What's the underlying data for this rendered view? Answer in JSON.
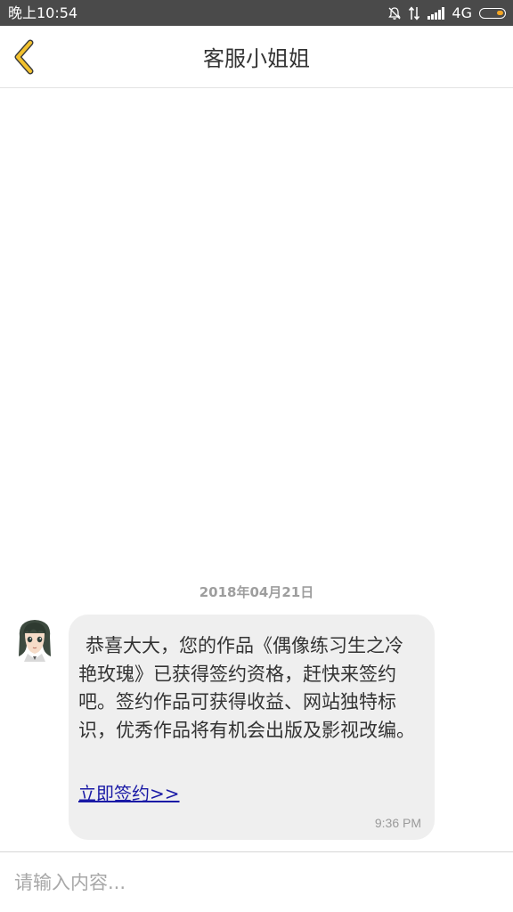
{
  "status_bar": {
    "time": "晚上10:54",
    "network": "4G",
    "icons": [
      "bell-muted-icon",
      "data-arrows-icon",
      "signal-icon",
      "battery-icon"
    ],
    "battery_color": "#f5a623"
  },
  "header": {
    "back_icon": "chevron-left-icon",
    "back_icon_color": "#f2c12e",
    "title": "客服小姐姐"
  },
  "chat": {
    "date": "2018年04月21日",
    "messages": [
      {
        "sender_avatar": "avatar",
        "text": "恭喜大大，您的作品《偶像练习生之冷艳玫瑰》已获得签约资格，赶快来签约吧。签约作品可获得收益、网站独特标识，优秀作品将有机会出版及影视改编。",
        "link_label": "立即签约>>",
        "time": "9:36 PM"
      }
    ]
  },
  "input": {
    "placeholder": "请输入内容..."
  }
}
